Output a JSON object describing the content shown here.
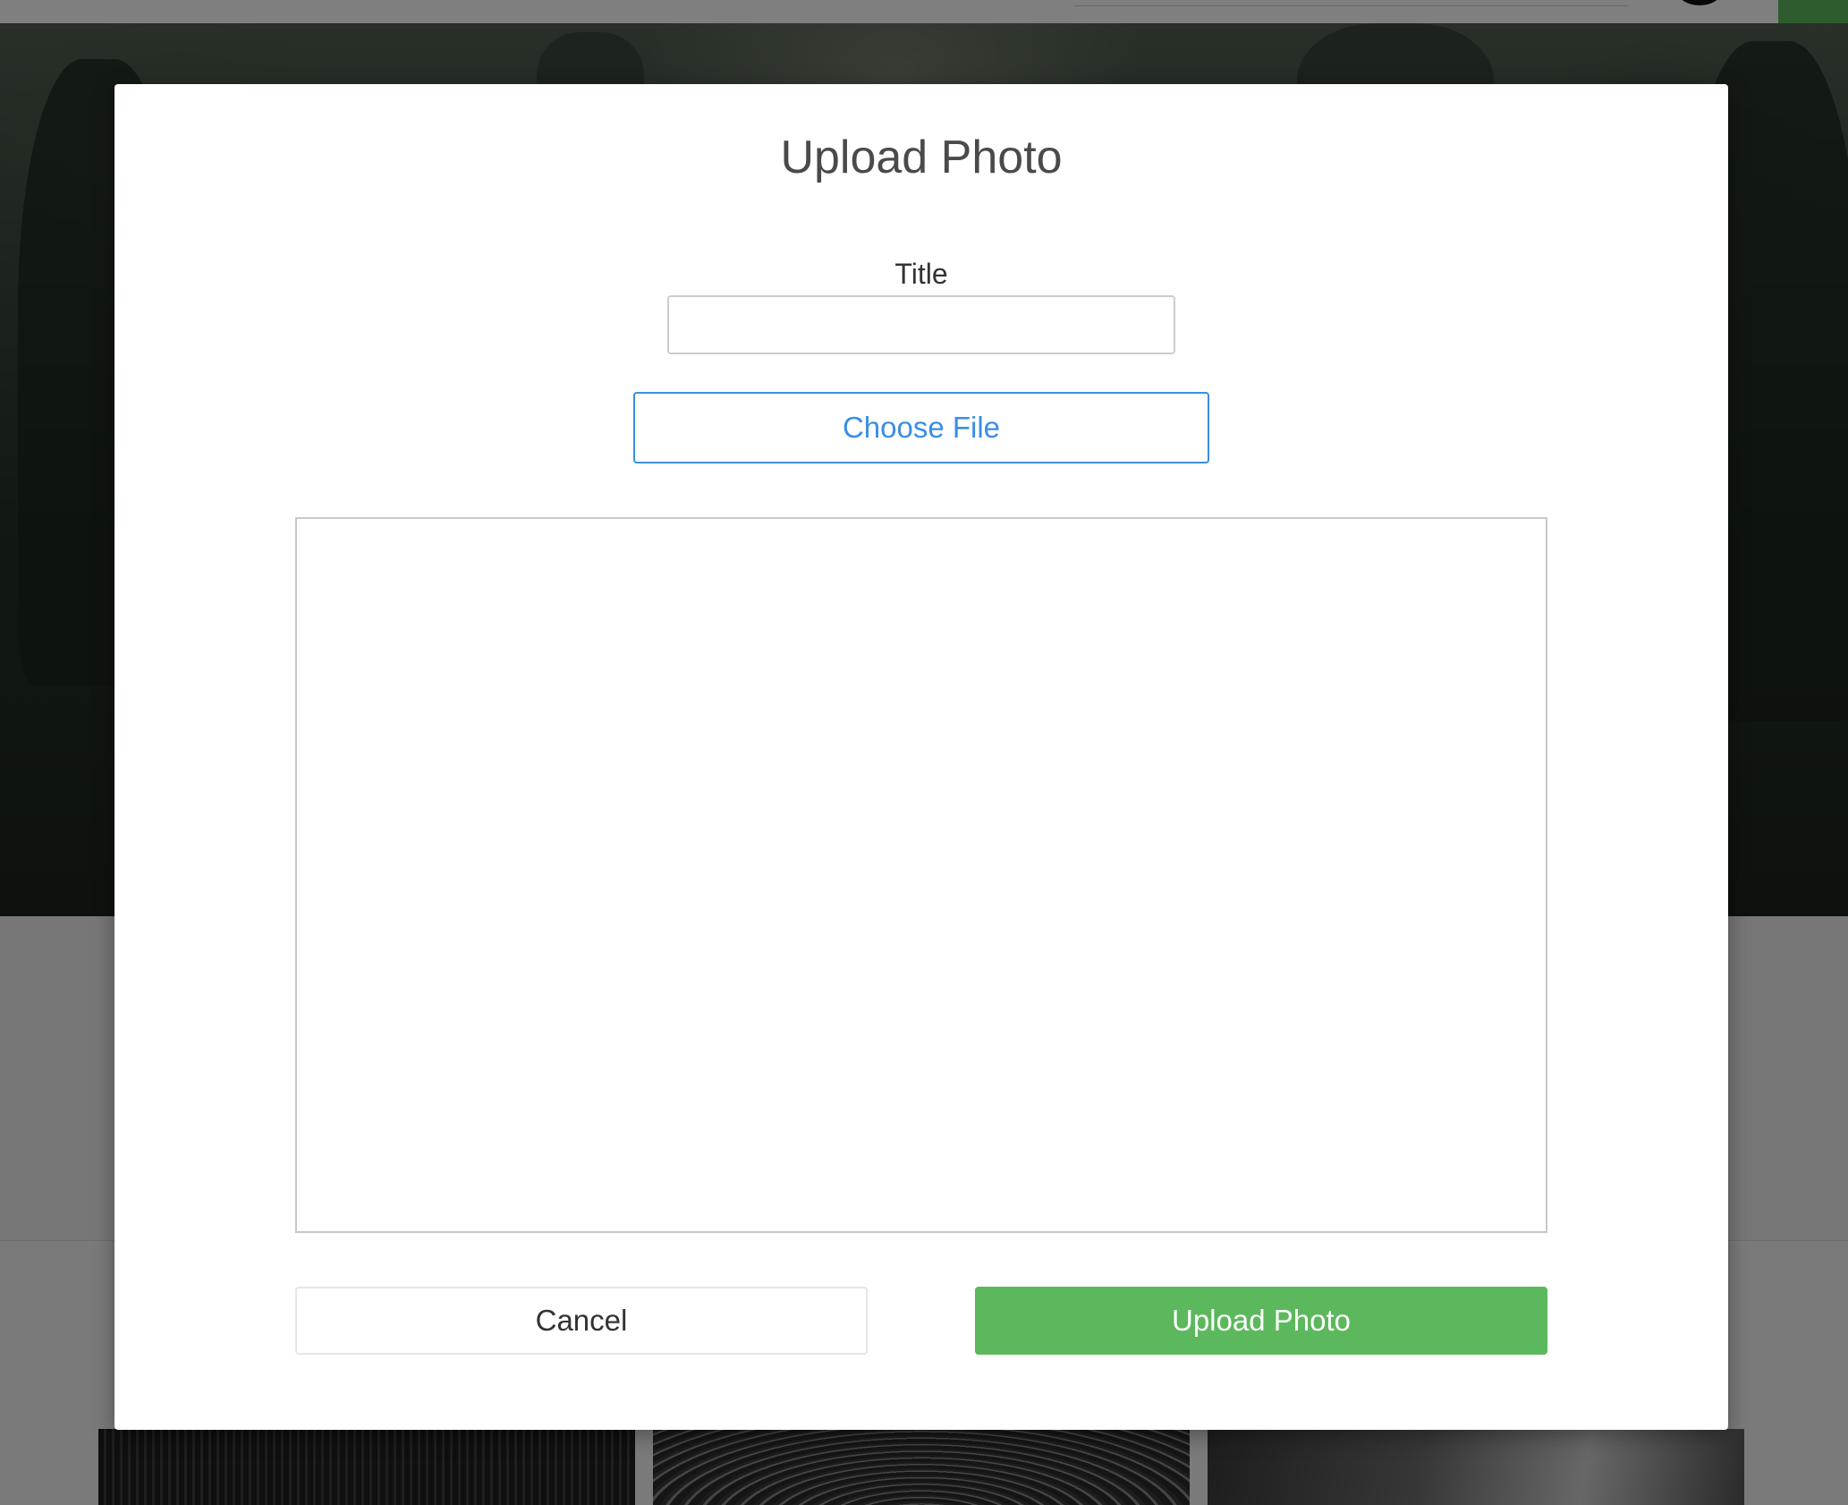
{
  "modal": {
    "title": "Upload Photo",
    "title_field": {
      "label": "Title",
      "value": "",
      "placeholder": ""
    },
    "choose_file_label": "Choose File",
    "cancel_label": "Cancel",
    "submit_label": "Upload Photo"
  },
  "colors": {
    "accent_blue": "#3a8ee6",
    "success_green": "#5cb85c",
    "overlay": "rgba(0,0,0,0.5)"
  }
}
